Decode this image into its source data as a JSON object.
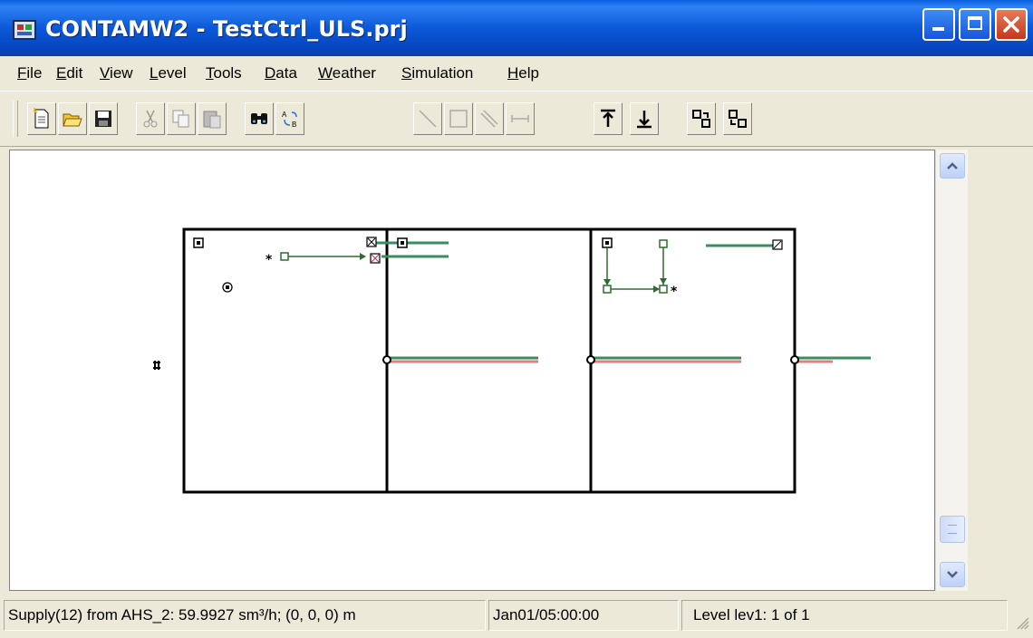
{
  "window": {
    "title": "CONTAMW2 - TestCtrl_ULS.prj",
    "buttons": [
      "minimize",
      "maximize",
      "close"
    ]
  },
  "menu": {
    "items": [
      {
        "label": "File",
        "mnemonic": "F"
      },
      {
        "label": "Edit",
        "mnemonic": "E"
      },
      {
        "label": "View",
        "mnemonic": "V"
      },
      {
        "label": "Level",
        "mnemonic": "L"
      },
      {
        "label": "Tools",
        "mnemonic": "T"
      },
      {
        "label": "Data",
        "mnemonic": "D"
      },
      {
        "label": "Weather",
        "mnemonic": "W"
      },
      {
        "label": "Simulation",
        "mnemonic": "S"
      },
      {
        "label": "Help",
        "mnemonic": "H"
      }
    ]
  },
  "toolbar": {
    "buttons": [
      {
        "icon": "new-file-icon"
      },
      {
        "icon": "open-folder-icon"
      },
      {
        "icon": "save-icon"
      },
      {
        "icon": "cut-icon"
      },
      {
        "icon": "copy-icon"
      },
      {
        "icon": "paste-icon"
      },
      {
        "icon": "find-icon"
      },
      {
        "icon": "replace-icon"
      },
      {
        "icon": "draw-line-icon"
      },
      {
        "icon": "draw-rectangle-icon"
      },
      {
        "icon": "draw-diagonal-icon"
      },
      {
        "icon": "draw-dimension-icon"
      },
      {
        "icon": "level-up-icon"
      },
      {
        "icon": "level-down-icon"
      },
      {
        "icon": "move-icon-a"
      },
      {
        "icon": "move-icon-b"
      }
    ]
  },
  "colors": {
    "wall": "#000000",
    "supply_path": "#3a8d5f",
    "return_path": "#e87c7c",
    "control_link": "#2d6e2d"
  },
  "status": {
    "message": "Supply(12) from AHS_2:  59.9927 sm³/h; (0, 0, 0) m",
    "time": "Jan01/05:00:00",
    "level": "Level lev1: 1 of 1"
  }
}
